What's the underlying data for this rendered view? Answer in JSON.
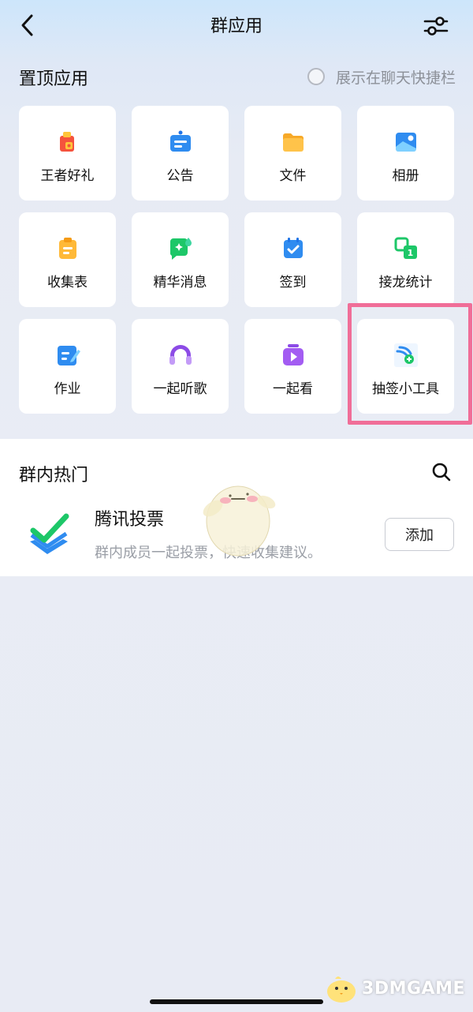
{
  "header": {
    "title": "群应用"
  },
  "pinned": {
    "title": "置顶应用",
    "show_in_chat_label": "展示在聊天快捷栏",
    "apps": [
      {
        "label": "王者好礼",
        "icon": "gift-icon"
      },
      {
        "label": "公告",
        "icon": "announcement-icon"
      },
      {
        "label": "文件",
        "icon": "folder-icon"
      },
      {
        "label": "相册",
        "icon": "album-icon"
      },
      {
        "label": "收集表",
        "icon": "clipboard-icon"
      },
      {
        "label": "精华消息",
        "icon": "highlight-message-icon"
      },
      {
        "label": "签到",
        "icon": "calendar-check-icon"
      },
      {
        "label": "接龙统计",
        "icon": "relay-stats-icon"
      },
      {
        "label": "作业",
        "icon": "homework-icon"
      },
      {
        "label": "一起听歌",
        "icon": "music-icon"
      },
      {
        "label": "一起看",
        "icon": "watch-together-icon"
      },
      {
        "label": "抽签小工具",
        "icon": "lottery-tool-icon"
      }
    ]
  },
  "hot": {
    "title": "群内热门",
    "item": {
      "name": "腾讯投票",
      "desc": "群内成员一起投票，快速收集建议。",
      "add_label": "添加"
    }
  },
  "watermark": "3DMGAME",
  "colors": {
    "highlight_border": "#f06e98",
    "accent_blue": "#2f8cf0"
  }
}
